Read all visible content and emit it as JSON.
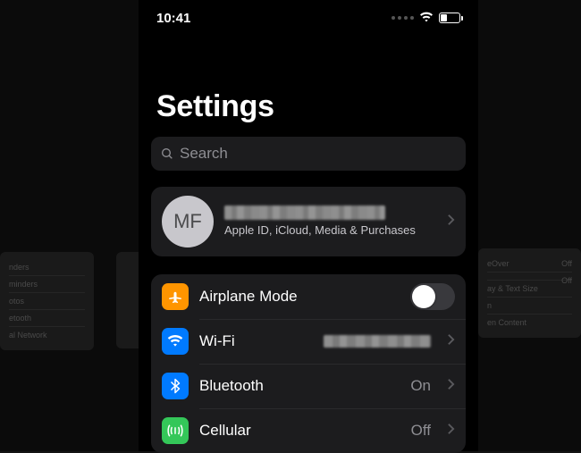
{
  "statusbar": {
    "time": "10:41"
  },
  "title": "Settings",
  "search": {
    "placeholder": "Search"
  },
  "account": {
    "initials": "MF",
    "subtitle": "Apple ID, iCloud, Media & Purchases"
  },
  "rows": {
    "airplane": {
      "label": "Airplane Mode",
      "on": false
    },
    "wifi": {
      "label": "Wi-Fi"
    },
    "bt": {
      "label": "Bluetooth",
      "value": "On"
    },
    "cell": {
      "label": "Cellular",
      "value": "Off"
    }
  },
  "bg_left": [
    "nders",
    "minders",
    "otos",
    "etooth",
    "al Network"
  ],
  "bg_right": [
    {
      "l": "eOver",
      "v": "Off"
    },
    {
      "l": "",
      "v": "Off"
    },
    {
      "l": "ay & Text Size",
      "v": ""
    },
    {
      "l": "n",
      "v": ""
    },
    {
      "l": "en Content",
      "v": ""
    }
  ]
}
